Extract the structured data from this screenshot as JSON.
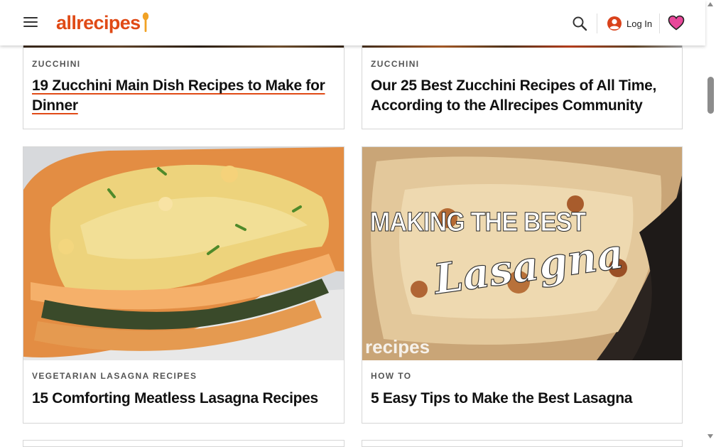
{
  "header": {
    "logo_text": "allrecipes",
    "login_label": "Log In",
    "brand_color": "#e04a16",
    "heart_color": "#e8489a",
    "icons": [
      "menu-icon",
      "search-icon",
      "user-icon",
      "heart-icon"
    ]
  },
  "cards": [
    {
      "tag": "ZUCCHINI",
      "title": "19 Zucchini Main Dish Recipes to Make for Dinner"
    },
    {
      "tag": "ZUCCHINI",
      "title": "Our 25 Best Zucchini Recipes of All Time, According to the Allrecipes Community"
    },
    {
      "tag": "VEGETARIAN LASAGNA RECIPES",
      "title": "15 Comforting Meatless Lasagna Recipes",
      "image": "vegetarian lasagna photo"
    },
    {
      "tag": "HOW TO",
      "title": "5 Easy Tips to Make the Best Lasagna",
      "image": "lasagna video thumbnail",
      "image_text": {
        "line1": "MAKING THE BEST",
        "line2": "Lasagna",
        "watermark": "recipes"
      }
    }
  ]
}
